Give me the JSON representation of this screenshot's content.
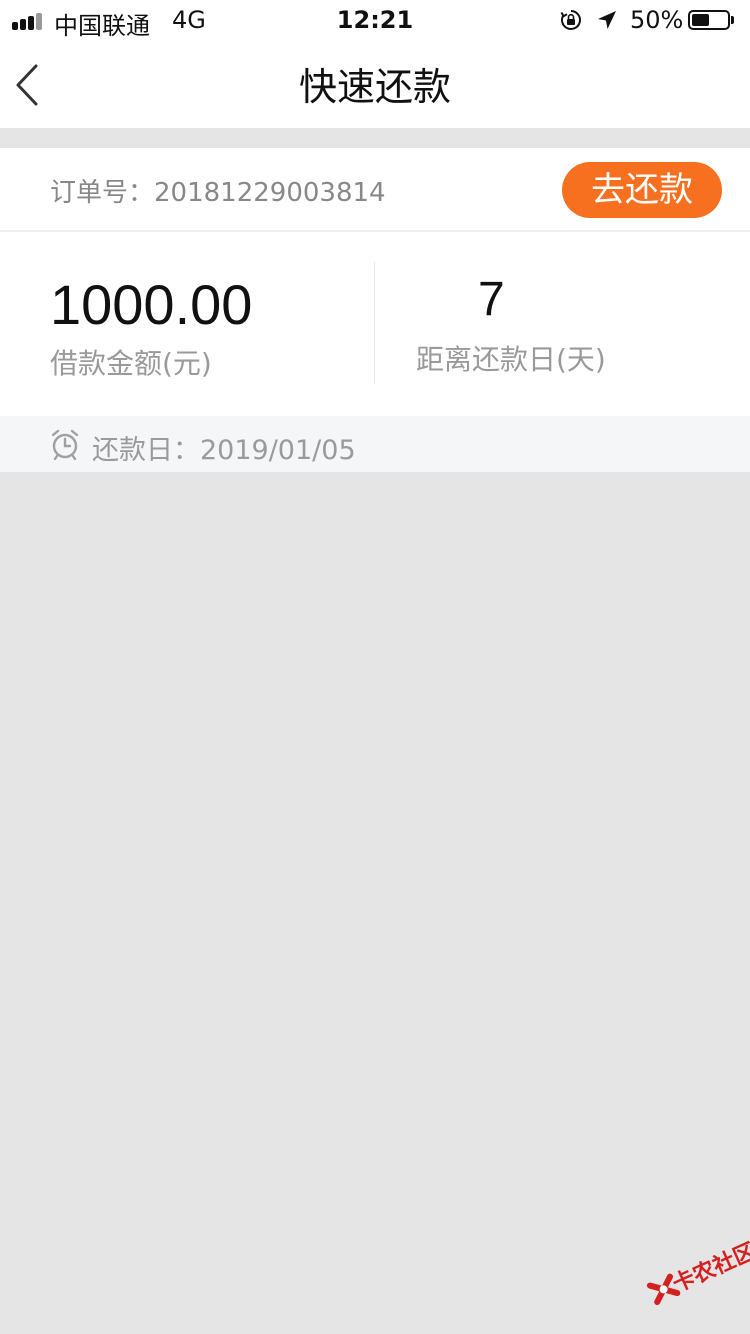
{
  "status_bar": {
    "carrier": "中国联通",
    "network": "4G",
    "time": "12:21",
    "battery_percent": "50%",
    "battery_level": 0.5
  },
  "nav": {
    "title": "快速还款"
  },
  "order": {
    "label": "订单号：20181229003814",
    "pay_button": "去还款"
  },
  "stats": {
    "loan_amount": "1000.00",
    "loan_label": "借款金额(元)",
    "days_left": "7",
    "days_label": "距离还款日(天)"
  },
  "due": {
    "label": "还款日：2019/01/05"
  },
  "watermark": {
    "text": "卡农社区"
  },
  "colors": {
    "accent": "#f7701f",
    "background": "#e5e5e5",
    "muted_text": "#9a9a9a"
  },
  "icons": {
    "back": "chevron-left-icon",
    "alarm": "alarm-clock-icon",
    "lock": "orientation-lock-icon",
    "location": "location-arrow-icon"
  }
}
